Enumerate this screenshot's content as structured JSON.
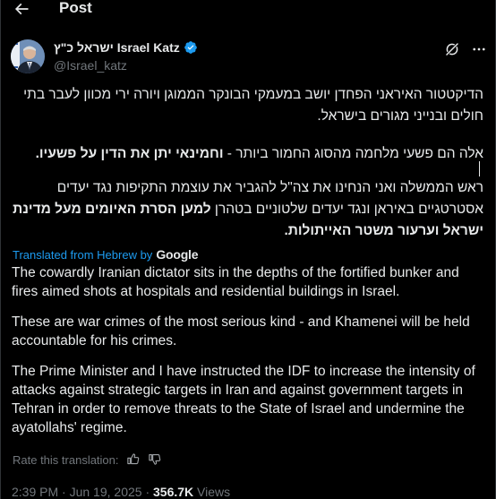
{
  "header": {
    "title": "Post"
  },
  "author": {
    "display_name": "ישראל כ\"ץ Israel Katz",
    "handle": "@Israel_katz"
  },
  "hebrew": {
    "p1": "הדיקטטור האיראני הפחדן יושב במעמקי הבונקר הממוגן ויורה ירי מכוון לעבר בתי חולים ובנייני מגורים בישראל.",
    "p2_regular": "אלה הם פשעי מלחמה מהסוג החמור ביותר - ",
    "p2_bold": "וחמינאי יתן את הדין על פשעיו.",
    "p3_regular": "ראש הממשלה ואני הנחינו את צה\"ל להגביר את עוצמת התקיפות נגד יעדים אסטרטגיים באיראן ונגד יעדים שלטוניים בטהרן ",
    "p3_bold": "למען הסרת האיומים מעל מדינת ישראל וערעור משטר האייתולות."
  },
  "translation": {
    "label": "Translated from Hebrew by",
    "provider": "Google"
  },
  "english": {
    "p1": "The cowardly Iranian dictator sits in the depths of the fortified bunker and fires aimed shots at hospitals and residential buildings in Israel.",
    "p2": "These are war crimes of the most serious kind - and Khamenei will be held accountable for his crimes.",
    "p3": "The Prime Minister and I have instructed the IDF to increase the intensity of attacks against strategic targets in Iran and against government targets in Tehran in order to remove threats to the State of Israel and undermine the ayatollahs' regime."
  },
  "rate": {
    "label": "Rate this translation:"
  },
  "meta": {
    "time": "2:39 PM",
    "date": "Jun 19, 2025",
    "separator": " · ",
    "views_count": "356.7K",
    "views_label": " Views"
  },
  "colors": {
    "background": "#000000",
    "text": "#e7e9ea",
    "secondary": "#71767b",
    "accent": "#1d9bf0"
  },
  "icons": {
    "back": "arrow-left-icon",
    "verified": "verified-badge-icon",
    "grok": "grok-icon",
    "more": "more-icon",
    "thumbs_up": "thumbs-up-icon",
    "thumbs_down": "thumbs-down-icon"
  }
}
